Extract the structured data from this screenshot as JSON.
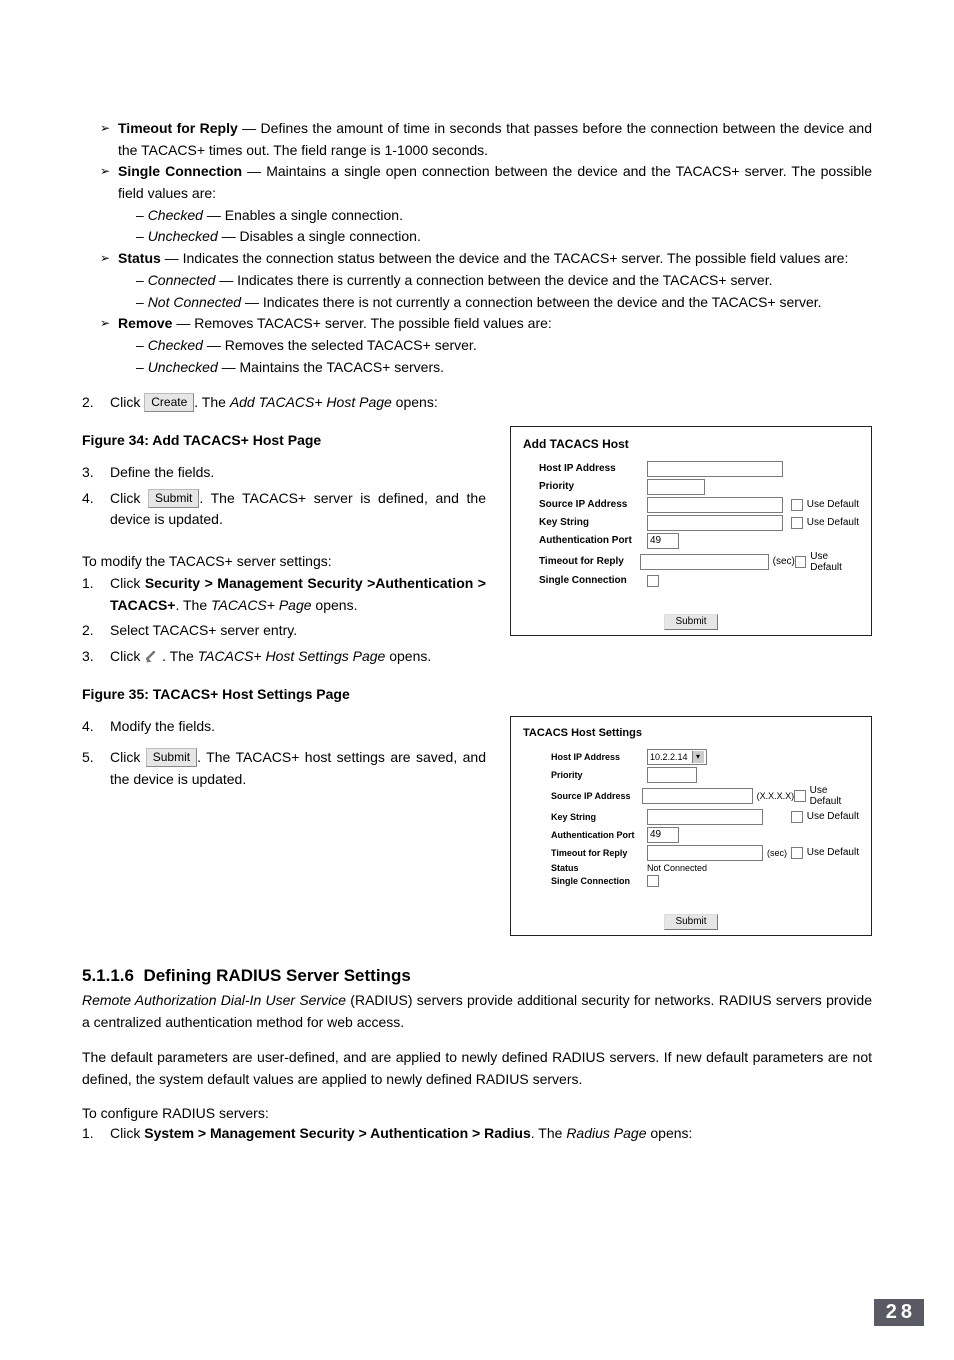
{
  "bullets": {
    "timeout": {
      "label": "Timeout for Reply",
      "text": " — Defines the amount of time in seconds that passes before the connection between the device and the TACACS+ times out. The field range is 1-1000 seconds."
    },
    "single": {
      "label": "Single Connection",
      "text": " — Maintains a single open connection between the device and the TACACS+ server. The possible field values are:",
      "opt1_k": "Checked",
      "opt1_v": " — Enables a single connection.",
      "opt2_k": "Unchecked",
      "opt2_v": " — Disables a single connection."
    },
    "status": {
      "label": "Status",
      "text": " — Indicates the connection status between the device and the TACACS+ server. The possible field values are:",
      "opt1_k": "Connected",
      "opt1_v": " — Indicates there is currently a connection between the device and the TACACS+ server.",
      "opt2_k": "Not Connected",
      "opt2_v": " — Indicates there is not currently a connection between the device and the TACACS+ server."
    },
    "remove": {
      "label": "Remove",
      "text": " — Removes TACACS+ server. The possible field values are:",
      "opt1_k": "Checked",
      "opt1_v": " — Removes the selected TACACS+ server.",
      "opt2_k": "Unchecked",
      "opt2_v": " — Maintains the TACACS+ servers."
    }
  },
  "step2": {
    "pre": "Click ",
    "btn": "Create",
    "post1": ". The ",
    "post_i": "Add TACACS+ Host Page",
    "post2": " opens:"
  },
  "fig34": "Figure 34: Add TACACS+ Host Page",
  "fig35": "Figure 35: TACACS+ Host Settings Page",
  "define": {
    "s3": "Define the fields.",
    "s4_pre": "Click ",
    "s4_btn": "Submit",
    "s4_post": ". The TACACS+ server is defined, and the device is updated."
  },
  "modify_intro": "To modify the TACACS+ server settings:",
  "modify": {
    "s1_pre": "Click ",
    "s1_bold": "Security > Management Security >Authentication > TACACS+",
    "s1_post1": ". The ",
    "s1_i": "TACACS+ Page",
    "s1_post2": " opens.",
    "s2": "Select TACACS+ server entry.",
    "s3_pre": "Click ",
    "s3_post1": " . The ",
    "s3_i": "TACACS+ Host Settings Page",
    "s3_post2": " opens.",
    "s4": "Modify the fields.",
    "s5_pre": "Click ",
    "s5_btn": "Submit",
    "s5_post": ". The TACACS+ host settings are saved, and the device is updated."
  },
  "panel1": {
    "title": "Add TACACS Host",
    "host": "Host IP Address",
    "priority": "Priority",
    "src": "Source IP Address",
    "key": "Key String",
    "auth": "Authentication Port",
    "auth_val": "49",
    "timeout": "Timeout for Reply",
    "sec": "(sec)",
    "single": "Single Connection",
    "use_default": "Use Default",
    "submit": "Submit"
  },
  "panel2": {
    "title": "TACACS Host Settings",
    "host": "Host IP Address",
    "host_val": "10.2.2.14",
    "priority": "Priority",
    "src": "Source IP Address",
    "key": "Key String",
    "auth": "Authentication Port",
    "auth_val": "49",
    "timeout": "Timeout for Reply",
    "sec": "(sec)",
    "status": "Status",
    "status_val": "Not Connected",
    "single": "Single Connection",
    "use_default": "Use Default",
    "xxxx": "(X.X.X.X)",
    "submit": "Submit"
  },
  "sec_num": "5.1.1.6",
  "sec_title": "Defining RADIUS Server Settings",
  "radius_p1_i": "Remote Authorization Dial-In User Service",
  "radius_p1": " (RADIUS) servers provide additional security for networks. RADIUS servers provide a centralized authentication method for web access.",
  "radius_p2": "The default parameters are user-defined, and are applied to newly defined RADIUS servers. If new default parameters are not defined, the system default values are applied to newly defined RADIUS servers.",
  "radius_cfg": "To configure RADIUS servers:",
  "radius_s1_pre": "Click ",
  "radius_s1_bold": "System > Management Security > Authentication > Radius",
  "radius_s1_post1": ". The ",
  "radius_s1_i": "Radius Page",
  "radius_s1_post2": " opens:",
  "page_number": "28"
}
